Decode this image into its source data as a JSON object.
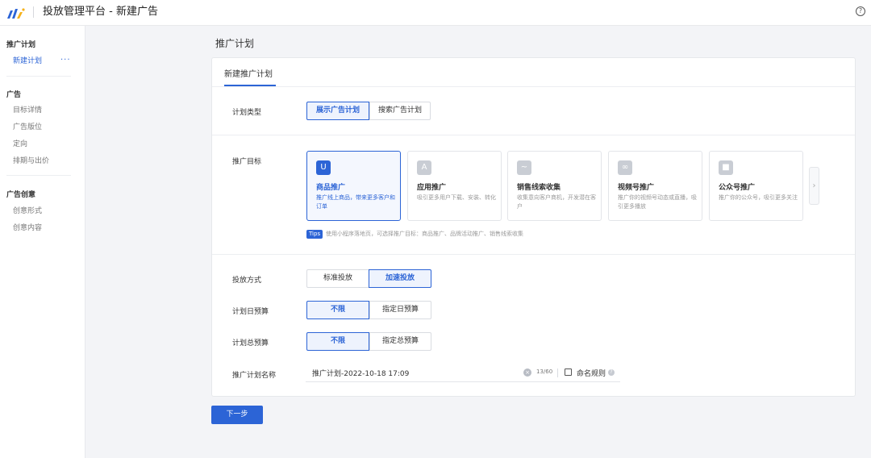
{
  "header": {
    "app_title": "投放管理平台 - 新建广告",
    "help": "?"
  },
  "sidebar": {
    "groups": [
      {
        "title": "推广计划",
        "items": [
          "新建计划"
        ]
      },
      {
        "title": "广告",
        "items": [
          "目标详情",
          "广告版位",
          "定向",
          "排期与出价"
        ]
      },
      {
        "title": "广告创意",
        "items": [
          "创意形式",
          "创意内容"
        ]
      }
    ],
    "more": "···"
  },
  "main": {
    "page_title": "推广计划",
    "tab": "新建推广计划",
    "plan_type": {
      "label": "计划类型",
      "options": [
        "展示广告计划",
        "搜索广告计划"
      ],
      "selected": "展示广告计划"
    },
    "goal": {
      "label": "推广目标",
      "cards": [
        {
          "title": "商品推广",
          "desc": "推广线上商品，带来更多客户和订单",
          "icon": "shopping-bag-icon",
          "glyph": "U"
        },
        {
          "title": "应用推广",
          "desc": "吸引更多用户下载、安装、转化",
          "icon": "app-icon",
          "glyph": "A"
        },
        {
          "title": "销售线索收集",
          "desc": "收集意向客户商机，开发潜在客户",
          "icon": "leads-icon",
          "glyph": "~"
        },
        {
          "title": "视频号推广",
          "desc": "推广你的视频号动态或直播，吸引更多播放",
          "icon": "video-channel-icon",
          "glyph": "∞"
        },
        {
          "title": "公众号推广",
          "desc": "推广你的公众号，吸引更多关注",
          "icon": "official-account-icon",
          "glyph": "■"
        }
      ],
      "selected": "商品推广",
      "next_glyph": "›",
      "tips_badge": "Tips",
      "tips_text": "使用小程序落地页，可选择推广目标：商品推广、品牌活动推广、销售线索收集"
    },
    "delivery": {
      "label": "投放方式",
      "options": [
        "标准投放",
        "加速投放"
      ],
      "selected": "加速投放"
    },
    "daily_budget": {
      "label": "计划日预算",
      "options": [
        "不限",
        "指定日预算"
      ],
      "selected": "不限"
    },
    "total_budget": {
      "label": "计划总预算",
      "options": [
        "不限",
        "指定总预算"
      ],
      "selected": "不限"
    },
    "plan_name": {
      "label": "推广计划名称",
      "value": "推广计划-2022-10-18 17:09",
      "count": "13/60",
      "rule_label": "命名规则",
      "clear_glyph": "×",
      "q_glyph": "?"
    },
    "next_button": "下一步"
  },
  "colors": {
    "accent": "#2c64d6",
    "background": "#f3f4f7"
  }
}
